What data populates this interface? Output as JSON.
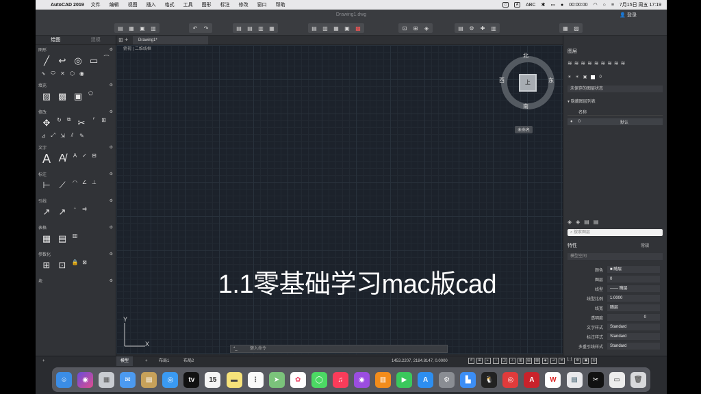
{
  "menubar": {
    "app": "AutoCAD 2019",
    "items": [
      "文件",
      "编辑",
      "视图",
      "插入",
      "格式",
      "工具",
      "图形",
      "标注",
      "修改",
      "窗口",
      "帮助"
    ],
    "input_source": "ABC",
    "timer": "00:00:00",
    "datetime": "7月15日 周五  17:19"
  },
  "window": {
    "title": "Drawing1.dwg",
    "login_label": "登录"
  },
  "left_panel": {
    "tabs": [
      "绘图",
      "建模"
    ],
    "sections": [
      "图形",
      "填充",
      "修改",
      "文字",
      "标注",
      "引线",
      "表格",
      "参数化",
      "块"
    ]
  },
  "document_tab": {
    "label": "Drawing1*"
  },
  "breadcrumb": {
    "text": "俯视 | 二维线框"
  },
  "viewcube": {
    "north": "北",
    "south": "南",
    "east": "东",
    "west": "西",
    "face": "上",
    "wcs_label": "未命名"
  },
  "ucs": {
    "y": "Y",
    "x": "X"
  },
  "caption": "1.1零基础学习mac版cad",
  "command_line": {
    "prefix": "*_",
    "placeholder": "键入命令"
  },
  "right_panel": {
    "layers_title": "图层",
    "current_layer": "0",
    "layer_state": "未保存的图层状态",
    "hide_layer_list": "隐藏图层列表",
    "layer_column": "名称",
    "layer_row_name": "0",
    "layer_row_linetype": "默认",
    "search_placeholder": "搜索图层",
    "properties_title": "特性",
    "properties_tab": "常规",
    "model_space": "模型空间",
    "properties": [
      {
        "label": "颜色",
        "value": "■ 随层"
      },
      {
        "label": "图层",
        "value": "0"
      },
      {
        "label": "线型",
        "value": "—— 随层"
      },
      {
        "label": "线型比例",
        "value": "1.0000"
      },
      {
        "label": "线宽",
        "value": "随层"
      },
      {
        "label": "透明度",
        "value": "0"
      },
      {
        "label": "文字样式",
        "value": "Standard"
      },
      {
        "label": "标注样式",
        "value": "Standard"
      },
      {
        "label": "多重引线样式",
        "value": "Standard"
      }
    ]
  },
  "statusbar": {
    "layouts": [
      "模型",
      "布局1",
      "布局2"
    ],
    "coords": "1453.2207, 2184.8147, 0.0000",
    "scale": "1:1"
  },
  "dock_apps": [
    "Finder",
    "Siri",
    "Launchpad",
    "Mail",
    "Notes",
    "Safari",
    "TV",
    "Calendar",
    "Notes",
    "Reminders",
    "Maps",
    "Photos",
    "Messages",
    "Music",
    "Podcasts",
    "Books",
    "FaceTime",
    "App Store",
    "System Preferences",
    "Keynote",
    "QQ",
    "NetEase",
    "AutoCAD",
    "WPS",
    "Preview",
    "CapCut",
    "Folder",
    "Trash"
  ],
  "dock_calendar_day": "15"
}
